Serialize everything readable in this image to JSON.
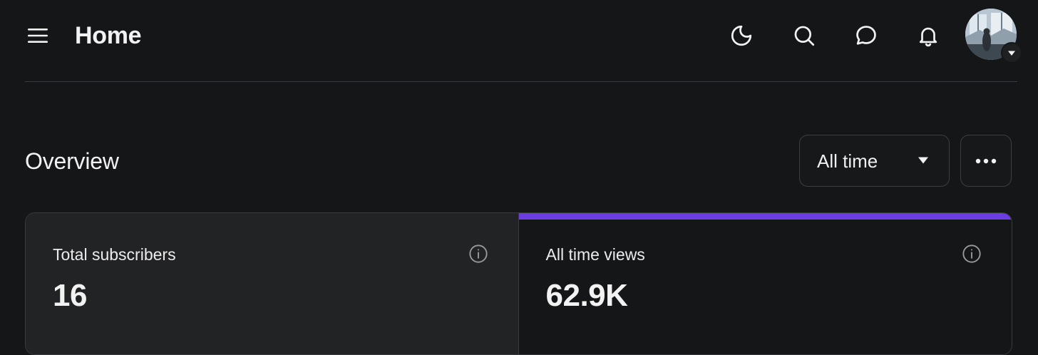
{
  "header": {
    "title": "Home",
    "icons": [
      "menu-icon",
      "moon-icon",
      "search-icon",
      "chat-icon",
      "bell-icon",
      "avatar",
      "chevron-down-icon"
    ]
  },
  "overview": {
    "title": "Overview",
    "range": {
      "selected": "All time"
    },
    "more_icon": "more-horizontal-icon"
  },
  "cards": [
    {
      "label": "Total subscribers",
      "value": "16",
      "selected": false
    },
    {
      "label": "All time views",
      "value": "62.9K",
      "selected": true
    }
  ],
  "colors": {
    "background": "#151618",
    "card_inactive": "#222324",
    "accent": "#6a3ee0",
    "text": "#f2f2f2",
    "icon_muted": "#9a9a9e"
  }
}
